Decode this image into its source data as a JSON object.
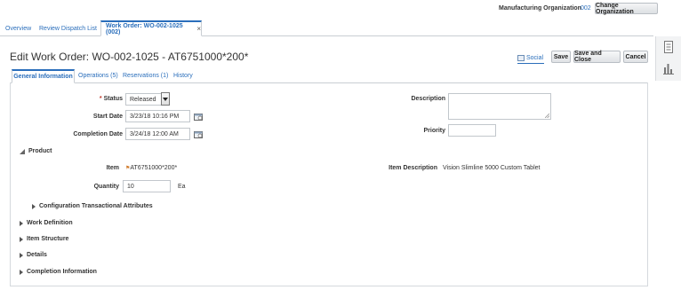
{
  "org": {
    "label": "Manufacturing Organization",
    "code": "002",
    "change_button": "Change Organization"
  },
  "tabs": [
    {
      "label": "Overview",
      "closable": false
    },
    {
      "label": "Review Dispatch List",
      "closable": true
    },
    {
      "label": "Work Order: WO-002-1025 (002)",
      "closable": true,
      "active": true
    }
  ],
  "close_glyph": "×",
  "page": {
    "title": "Edit Work Order: WO-002-1025 - AT6751000*200*"
  },
  "toolbar": {
    "social": "Social",
    "save": "Save",
    "save_and_close": "Save and Close",
    "cancel": "Cancel"
  },
  "subtabs": [
    {
      "label": "General Information",
      "active": true
    },
    {
      "label": "Operations (5)"
    },
    {
      "label": "Reservations (1)"
    },
    {
      "label": "History"
    }
  ],
  "form": {
    "required_mark": "*",
    "status_label": "Status",
    "status_value": "Released",
    "start_date_label": "Start Date",
    "start_date_value": "3/23/18 10:16 PM",
    "completion_date_label": "Completion Date",
    "completion_date_value": "3/24/18 12:00 AM",
    "description_label": "Description",
    "description_value": "",
    "priority_label": "Priority",
    "priority_value": ""
  },
  "product": {
    "section_label": "Product",
    "item_label": "Item",
    "item_value": "AT6751000*200*",
    "item_description_label": "Item Description",
    "item_description_value": "Vision Slimline 5000 Custom Tablet",
    "quantity_label": "Quantity",
    "quantity_value": "10",
    "uom": "Ea",
    "config_section": "Configuration Transactional Attributes"
  },
  "sections": [
    "Work Definition",
    "Item Structure",
    "Details",
    "Completion Information"
  ],
  "colors": {
    "link": "#2a6ebb",
    "border": "#c9ced3",
    "required": "#c0392b"
  }
}
